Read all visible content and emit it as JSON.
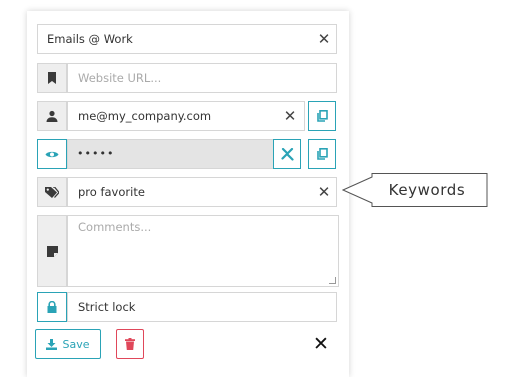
{
  "title": {
    "value": "Emails @ Work"
  },
  "url": {
    "placeholder": "Website URL..."
  },
  "username": {
    "value": "me@my_company.com"
  },
  "password": {
    "value": "•••••"
  },
  "keywords": {
    "value": "pro favorite"
  },
  "comments": {
    "placeholder": "Comments..."
  },
  "lock": {
    "label": "Strict lock"
  },
  "actions": {
    "save_label": "Save"
  },
  "callout": {
    "label": "Keywords"
  },
  "colors": {
    "accent": "#2aa3b6",
    "danger": "#e0475a",
    "border": "#d6d6d6",
    "addon_bg": "#eeeeee",
    "grey_bg": "#e4e4e4"
  },
  "icons": {
    "url": "bookmark-icon",
    "username": "user-icon",
    "password": "eye-icon",
    "keywords": "tags-icon",
    "comments": "note-icon",
    "lock": "lock-icon",
    "copy": "copy-icon",
    "generate": "generate-password-icon",
    "save": "download-icon",
    "delete": "trash-icon",
    "clear": "close-icon"
  }
}
